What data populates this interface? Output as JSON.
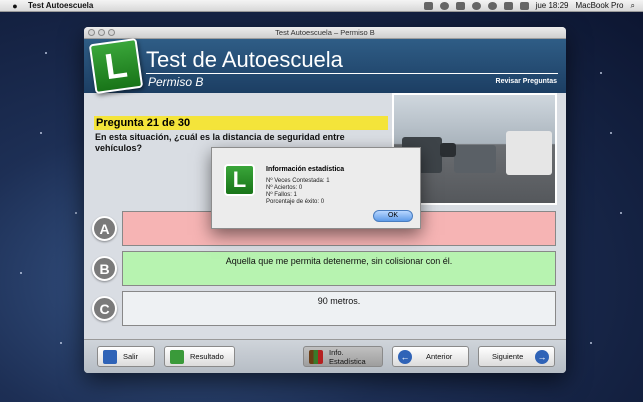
{
  "menubar": {
    "app_name": "Test Autoescuela",
    "clock": "jue 18:29",
    "user": "MacBook Pro"
  },
  "window": {
    "title": "Test Autoescuela – Permiso B"
  },
  "header": {
    "logo_letter": "L",
    "title": "Test de Autoescuela",
    "subtitle": "Permiso B",
    "review_link": "Revisar Preguntas"
  },
  "question": {
    "counter": "Pregunta 21 de 30",
    "text": "En esta situación, ¿cuál es la distancia de seguridad entre vehículos?"
  },
  "answers": [
    {
      "letter": "A",
      "text": "",
      "state": "wrong"
    },
    {
      "letter": "B",
      "text": "Aquella que me permita detenerme, sin colisionar con él.",
      "state": "correct"
    },
    {
      "letter": "C",
      "text": "90 metros.",
      "state": "neutral"
    }
  ],
  "dialog": {
    "logo_letter": "L",
    "title": "Información estadística",
    "lines": [
      "Nº Veces Contestada: 1",
      "Nº Aciertos: 0",
      "Nº Fallos: 1",
      "Porcentaje de éxito: 0"
    ],
    "ok_label": "OK"
  },
  "toolbar": {
    "exit_label": "Salir",
    "result_label": "Resultado",
    "stats_label": "Info. Estadística",
    "prev_label": "Anterior",
    "next_label": "Siguiente"
  },
  "colors": {
    "header": "#1c3e63",
    "question_bar": "#f4e43a",
    "wrong": "#f6b4b4",
    "correct": "#b7f3b0"
  }
}
